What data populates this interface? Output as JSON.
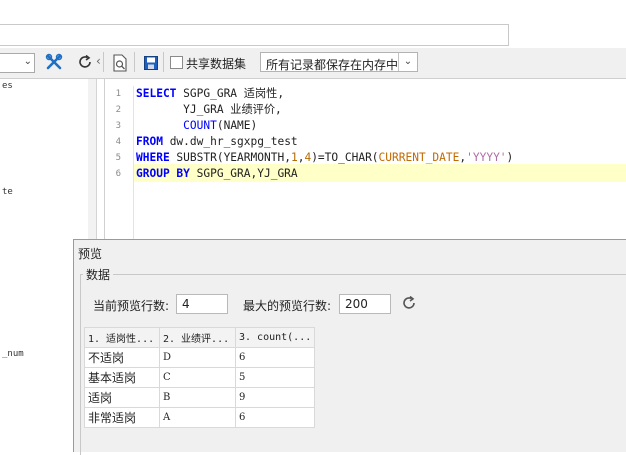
{
  "left_panel": {
    "items": [
      "es",
      "te",
      "_num"
    ]
  },
  "toolbar": {
    "share_dataset_label": "共享数据集",
    "storage_mode": "所有记录都保存在内存中"
  },
  "editor": {
    "line_numbers": [
      "1",
      "2",
      "3",
      "4",
      "5",
      "6"
    ],
    "lines": [
      [
        {
          "t": "SELECT",
          "c": "kw"
        },
        {
          "t": " SGPG_GRA 适岗性,",
          "c": "plain"
        }
      ],
      [
        {
          "t": "       YJ_GRA 业绩评价,",
          "c": "plain"
        }
      ],
      [
        {
          "t": "       ",
          "c": "plain"
        },
        {
          "t": "COUNT",
          "c": "fn"
        },
        {
          "t": "(NAME)",
          "c": "plain"
        }
      ],
      [
        {
          "t": "FROM",
          "c": "kw"
        },
        {
          "t": " dw.dw_hr_sgxpg_test",
          "c": "plain"
        }
      ],
      [
        {
          "t": "WHERE",
          "c": "kw"
        },
        {
          "t": " SUBSTR(YEARMONTH,",
          "c": "plain"
        },
        {
          "t": "1",
          "c": "num"
        },
        {
          "t": ",",
          "c": "plain"
        },
        {
          "t": "4",
          "c": "num"
        },
        {
          "t": ")=TO_CHAR(",
          "c": "plain"
        },
        {
          "t": "CURRENT_DATE",
          "c": "arg"
        },
        {
          "t": ",",
          "c": "plain"
        },
        {
          "t": "'YYYY'",
          "c": "str"
        },
        {
          "t": ")",
          "c": "plain"
        }
      ],
      [
        {
          "t": "GROUP BY",
          "c": "kw"
        },
        {
          "t": " SGPG_GRA,YJ_GRA",
          "c": "plain"
        }
      ]
    ]
  },
  "preview": {
    "title": "预览",
    "group_label": "数据",
    "current_rows_label": "当前预览行数:",
    "current_rows_value": "4",
    "max_rows_label": "最大的预览行数:",
    "max_rows_value": "200",
    "columns": [
      "1. 适岗性...",
      "2. 业绩评...",
      "3. count(..."
    ],
    "rows": [
      [
        "不适岗",
        "D",
        "6"
      ],
      [
        "基本适岗",
        "C",
        "5"
      ],
      [
        "适岗",
        "B",
        "9"
      ],
      [
        "非常适岗",
        "A",
        "6"
      ]
    ]
  }
}
